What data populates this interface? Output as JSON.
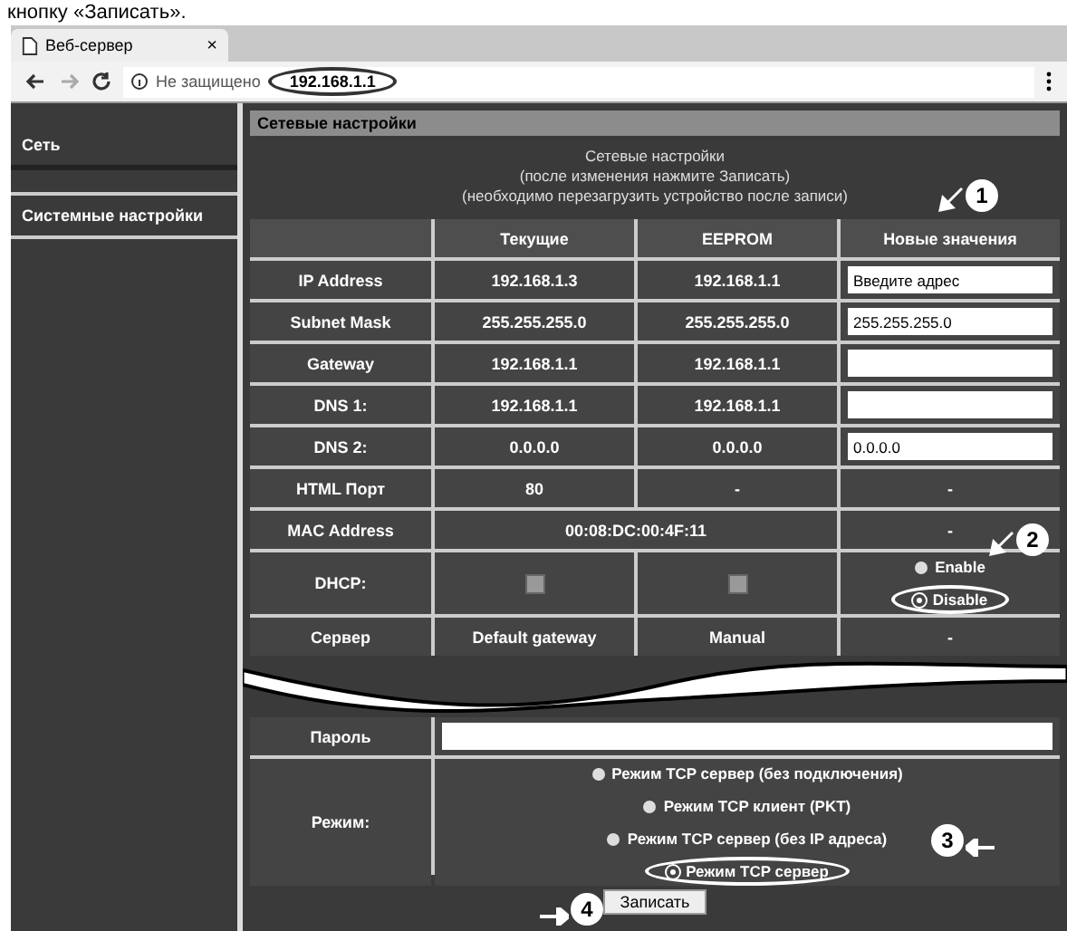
{
  "caption": "кнопку «Записать».",
  "browser": {
    "tab_title": "Веб-сервер",
    "tab_close": "×",
    "address_prefix": "Не защищено",
    "address": "192.168.1.1",
    "address_circled": true
  },
  "sidebar": {
    "items": [
      {
        "label": "Сеть",
        "selected": true
      },
      {
        "label": "Системные настройки",
        "selected": false
      }
    ]
  },
  "panel": {
    "title": "Сетевые настройки",
    "notes": [
      "Сетевые настройки",
      "(после изменения нажмите Записать)",
      "(необходимо перезагрузить устройство после записи)"
    ]
  },
  "table": {
    "columns": [
      "",
      "Текущие",
      "EEPROM",
      "Новые значения"
    ],
    "rows": [
      {
        "kind": "input",
        "label": "IP Address",
        "current": "192.168.1.3",
        "eeprom": "192.168.1.1",
        "value": "Введите адрес"
      },
      {
        "kind": "input",
        "label": "Subnet Mask",
        "current": "255.255.255.0",
        "eeprom": "255.255.255.0",
        "value": "255.255.255.0"
      },
      {
        "kind": "input",
        "label": "Gateway",
        "current": "192.168.1.1",
        "eeprom": "192.168.1.1"
      },
      {
        "kind": "input",
        "label": "DNS 1:",
        "current": "192.168.1.1",
        "eeprom": "192.168.1.1"
      },
      {
        "kind": "input",
        "label": "DNS 2:",
        "current": "0.0.0.0",
        "eeprom": "0.0.0.0",
        "value": "0.0.0.0"
      },
      {
        "kind": "text",
        "label": "HTML Порт",
        "current": "80",
        "eeprom": "-",
        "new": "-"
      },
      {
        "kind": "merged",
        "label": "MAC Address",
        "current": "00:08:DC:00:4F:11",
        "new": "-"
      },
      {
        "kind": "dhcp",
        "label": "DHCP:",
        "current_checked": false,
        "eeprom_checked": false,
        "options": [
          {
            "label": "Enable",
            "selected": false,
            "circled": false
          },
          {
            "label": "Disable",
            "selected": true,
            "circled": true
          }
        ]
      },
      {
        "kind": "text",
        "label": "Сервер",
        "current": "Default gateway",
        "eeprom": "Manual",
        "new": "-"
      }
    ]
  },
  "password": {
    "label": "Пароль"
  },
  "mode": {
    "label": "Режим:",
    "options": [
      {
        "label": "Режим TCP сервер (без подключения)",
        "selected": false,
        "circled": false
      },
      {
        "label": "Режим TCP клиент (PKT)",
        "selected": false,
        "circled": false
      },
      {
        "label": "Режим TCP сервер (без IP адреса)",
        "selected": false,
        "circled": false
      },
      {
        "label": "Режим TCP сервер",
        "selected": true,
        "circled": true
      }
    ]
  },
  "save_button": "Записать",
  "callouts": [
    "1",
    "2",
    "3",
    "4"
  ]
}
